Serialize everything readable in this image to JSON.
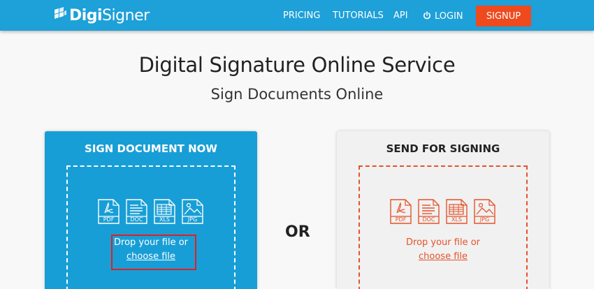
{
  "header": {
    "logo_prefix": "Digi",
    "logo_suffix": "Signer",
    "nav": {
      "pricing": "PRICING",
      "tutorials": "TUTORIALS",
      "api": "API",
      "login": "LOGIN"
    },
    "signup": "SIGNUP"
  },
  "hero": {
    "title": "Digital Signature Online Service",
    "subtitle": "Sign Documents Online"
  },
  "sign_panel": {
    "title": "SIGN DOCUMENT NOW",
    "file_types": [
      "PDF",
      "DOC",
      "XLS",
      "JPG"
    ],
    "drop_text": "Drop your file or",
    "choose_link": "choose file"
  },
  "or_label": "OR",
  "send_panel": {
    "title": "SEND FOR SIGNING",
    "file_types": [
      "PDF",
      "DOC",
      "XLS",
      "JPG"
    ],
    "drop_text": "Drop your file or",
    "choose_link": "choose file"
  },
  "colors": {
    "header_bg": "#1ea0d8",
    "signup_bg": "#ee4a1e",
    "sign_panel_bg": "#189ed6",
    "send_panel_bg": "#f1f1f1",
    "send_accent": "#e4532b",
    "highlight": "#e02020"
  },
  "icons": {
    "logo": "digisigner-logo-icon",
    "login": "power-icon",
    "files": [
      "pdf-file-icon",
      "doc-file-icon",
      "xls-file-icon",
      "jpg-file-icon"
    ]
  }
}
